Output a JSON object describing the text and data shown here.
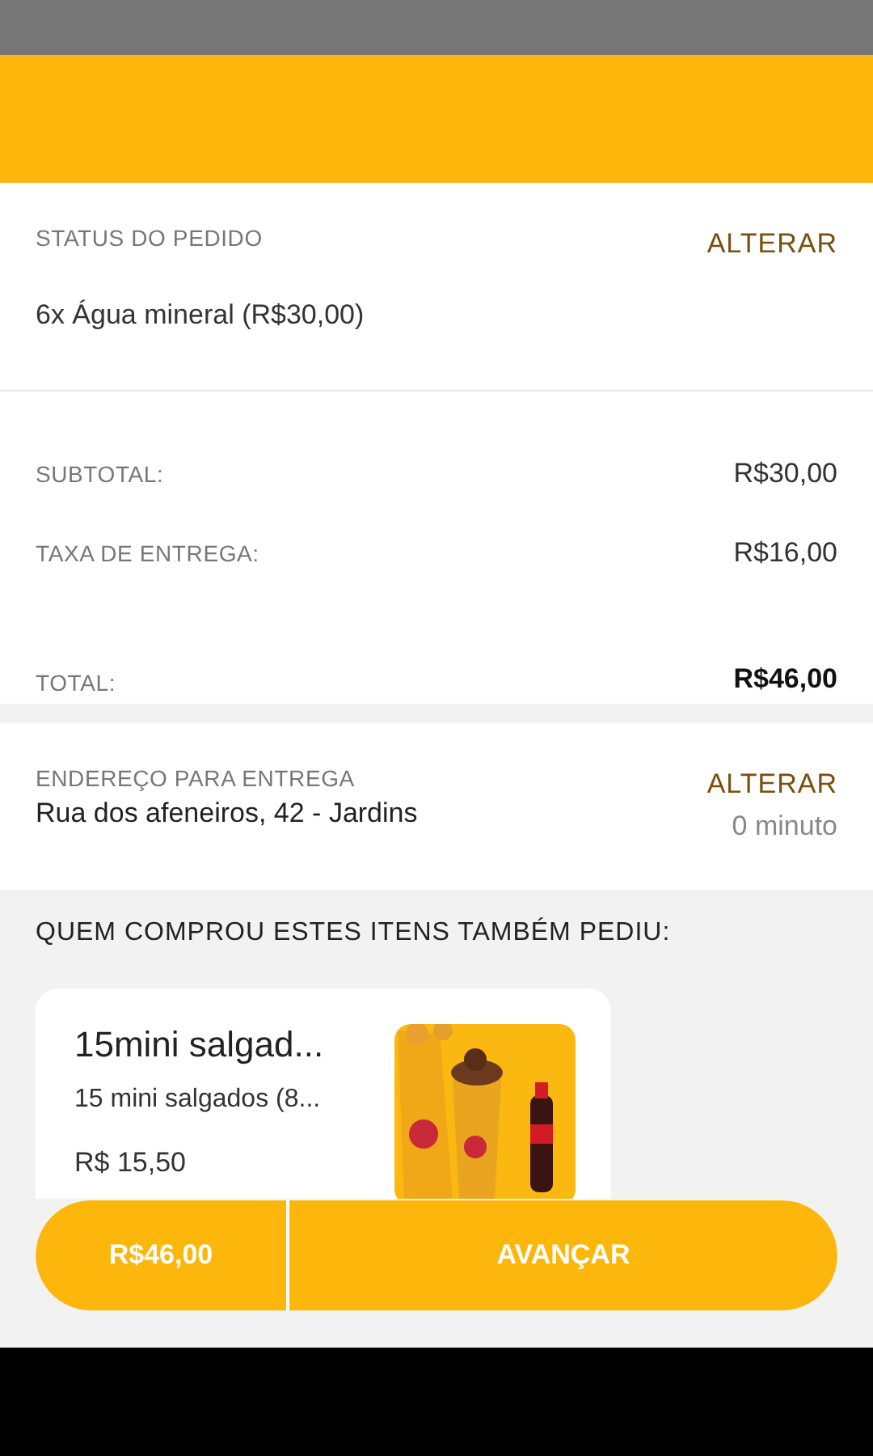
{
  "order_status": {
    "title": "STATUS DO PEDIDO",
    "action": "ALTERAR",
    "items": [
      "6x Água mineral (R$30,00)"
    ]
  },
  "totals": [
    {
      "kind": "line",
      "label": "SUBTOTAL:",
      "value": "R$30,00"
    },
    {
      "kind": "line",
      "label": "TAXA DE ENTREGA:",
      "value": "R$16,00"
    },
    {
      "kind": "total",
      "label": "TOTAL:",
      "value": "R$46,00"
    }
  ],
  "address": {
    "title": "ENDEREÇO PARA ENTREGA",
    "address": "Rua dos afeneiros, 42 - Jardins",
    "action": "ALTERAR",
    "time": "0 minuto"
  },
  "suggestions": {
    "title": "QUEM COMPROU ESTES ITENS TAMBÉM PEDIU:",
    "items": [
      {
        "name": "15mini salgad...",
        "description": "15 mini salgados (8...",
        "price": "R$ 15,50"
      }
    ]
  },
  "checkout": {
    "total": "R$46,00",
    "button": "AVANÇAR"
  }
}
